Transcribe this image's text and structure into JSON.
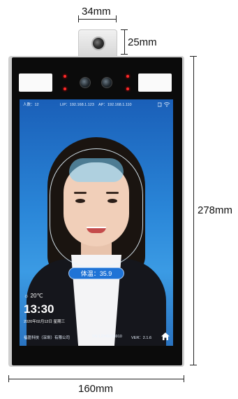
{
  "dimensions": {
    "top_width": "34mm",
    "camera_height": "25mm",
    "height": "278mm",
    "width": "160mm"
  },
  "screen": {
    "people_count": "人数：12",
    "ip": "LIP：192.168.1.123",
    "ap": "AP：192.168.1.110",
    "temperature": "体温：35.9",
    "weather": "☼ 20℃",
    "time": "13:30",
    "date": "2020年02月12日  星期三",
    "company": "福盈科技（深圳）有限公司",
    "serial": "SN:12345678910",
    "version": "VER：2.1.6"
  },
  "colors": {
    "screen_top": "#1a5fb8",
    "screen_bottom": "#2a73c0",
    "badge": "#1f73d6",
    "led": "#ff2a2a"
  },
  "icons": [
    "wifi-icon",
    "phone-link-icon",
    "home-icon",
    "sun-icon"
  ]
}
